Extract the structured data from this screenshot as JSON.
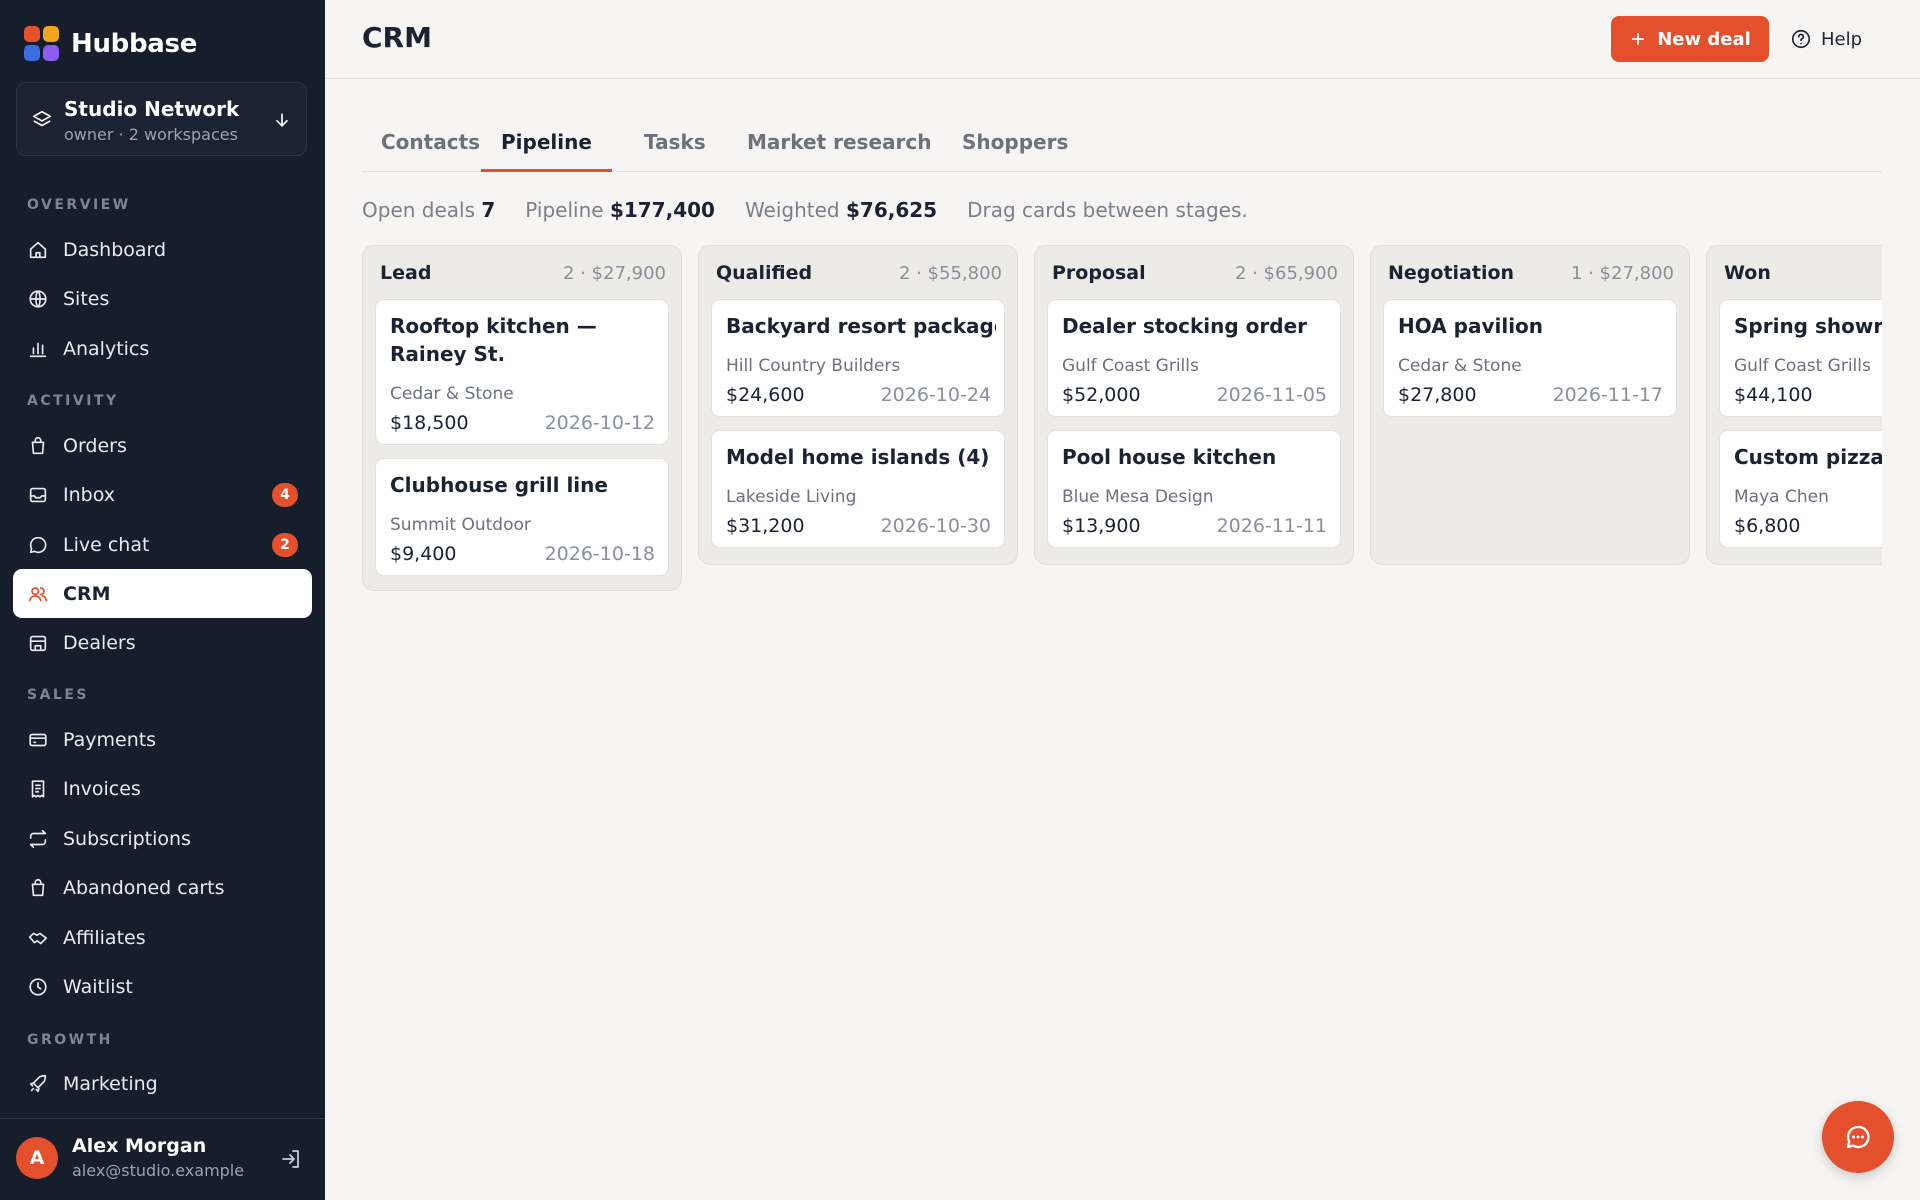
{
  "brand": {
    "name": "Hubbase",
    "colors": [
      "#e3502b",
      "#f2a61d",
      "#3b6fe0",
      "#8a5cf0"
    ]
  },
  "workspace": {
    "name": "Studio Network",
    "subtitle": "owner · 2 workspaces"
  },
  "nav": {
    "sections": {
      "overview": "OVERVIEW",
      "activity": "ACTIVITY",
      "sales": "SALES",
      "growth": "GROWTH"
    },
    "items": [
      {
        "label": "Dashboard",
        "icon": "home-icon"
      },
      {
        "label": "Sites",
        "icon": "globe-icon"
      },
      {
        "label": "Analytics",
        "icon": "bar-chart-icon"
      },
      {
        "label": "Orders",
        "icon": "shopping-bag-icon"
      },
      {
        "label": "Inbox",
        "icon": "inbox-icon",
        "badge": "4"
      },
      {
        "label": "Live chat",
        "icon": "chat-bubble-icon",
        "badge": "2"
      },
      {
        "label": "CRM",
        "icon": "users-icon",
        "active": true
      },
      {
        "label": "Dealers",
        "icon": "store-icon"
      },
      {
        "label": "Payments",
        "icon": "credit-card-icon"
      },
      {
        "label": "Invoices",
        "icon": "receipt-icon"
      },
      {
        "label": "Subscriptions",
        "icon": "repeat-icon"
      },
      {
        "label": "Abandoned carts",
        "icon": "shopping-bag-icon"
      },
      {
        "label": "Affiliates",
        "icon": "handshake-icon"
      },
      {
        "label": "Waitlist",
        "icon": "clock-icon"
      },
      {
        "label": "Marketing",
        "icon": "rocket-icon"
      }
    ]
  },
  "user": {
    "initial": "A",
    "name": "Alex Morgan",
    "email": "alex@studio.example"
  },
  "header": {
    "title": "CRM",
    "new_deal": "New deal",
    "help": "Help"
  },
  "tabs": [
    "Contacts",
    "Pipeline",
    "Tasks",
    "Market research",
    "Shoppers"
  ],
  "active_tab": "Pipeline",
  "stats": {
    "open_label": "Open deals",
    "open_value": "7",
    "pipeline_label": "Pipeline",
    "pipeline_value": "$177,400",
    "weighted_label": "Weighted",
    "weighted_value": "$76,625",
    "hint": "Drag cards between stages."
  },
  "columns": [
    {
      "name": "Lead",
      "meta": "2 · $27,900",
      "cards": [
        {
          "title": "Rooftop kitchen — Rainey St.",
          "company": "Cedar & Stone",
          "value": "$18,500",
          "date": "2026-10-12"
        },
        {
          "title": "Clubhouse grill line",
          "company": "Summit Outdoor",
          "value": "$9,400",
          "date": "2026-10-18"
        }
      ]
    },
    {
      "name": "Qualified",
      "meta": "2 · $55,800",
      "cards": [
        {
          "title": "Backyard resort package",
          "company": "Hill Country Builders",
          "value": "$24,600",
          "date": "2026-10-24"
        },
        {
          "title": "Model home islands (4)",
          "company": "Lakeside Living",
          "value": "$31,200",
          "date": "2026-10-30"
        }
      ]
    },
    {
      "name": "Proposal",
      "meta": "2 · $65,900",
      "cards": [
        {
          "title": "Dealer stocking order",
          "company": "Gulf Coast Grills",
          "value": "$52,000",
          "date": "2026-11-05"
        },
        {
          "title": "Pool house kitchen",
          "company": "Blue Mesa Design",
          "value": "$13,900",
          "date": "2026-11-11"
        }
      ]
    },
    {
      "name": "Negotiation",
      "meta": "1 · $27,800",
      "cards": [
        {
          "title": "HOA pavilion",
          "company": "Cedar & Stone",
          "value": "$27,800",
          "date": "2026-11-17"
        }
      ]
    },
    {
      "name": "Won",
      "meta": "",
      "cards": [
        {
          "title": "Spring showroo",
          "company": "Gulf Coast Grills",
          "value": "$44,100",
          "date": ""
        },
        {
          "title": "Custom pizza s",
          "company": "Maya Chen",
          "value": "$6,800",
          "date": ""
        }
      ]
    }
  ],
  "colors": {
    "accent": "#e3502b",
    "sidebar": "#161d2b",
    "background": "#f6f5f3"
  }
}
